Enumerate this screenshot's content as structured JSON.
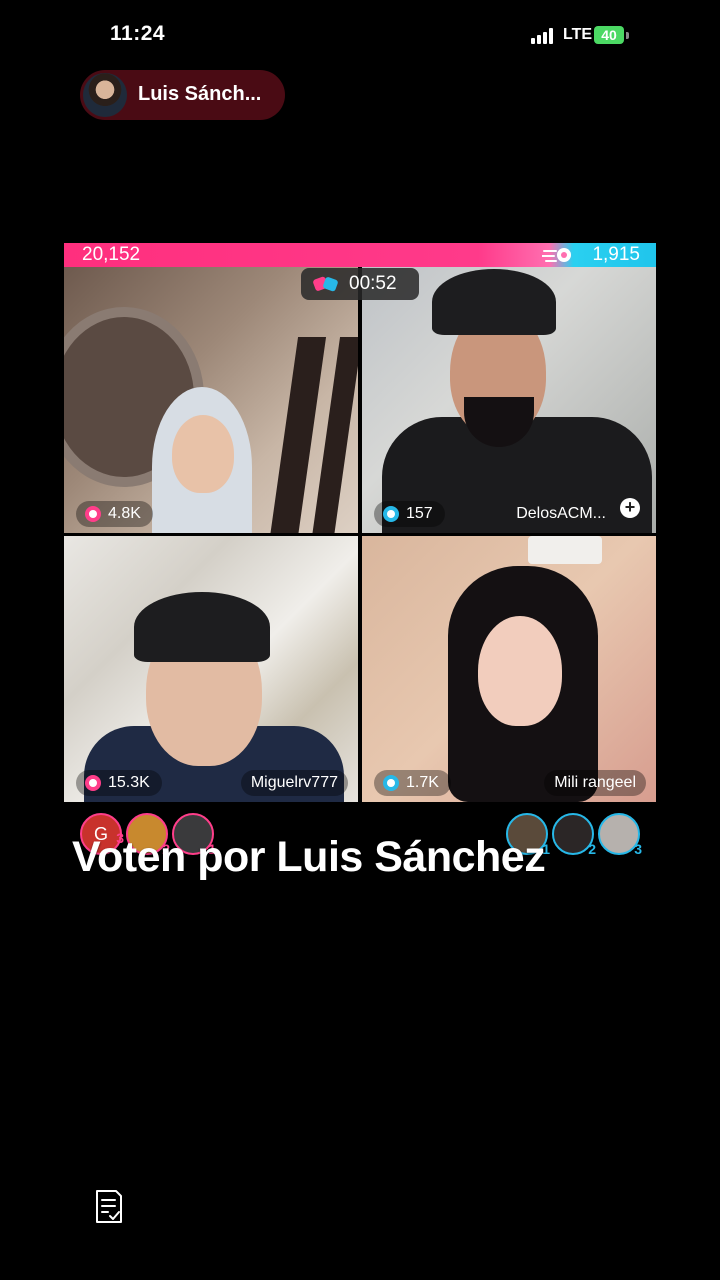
{
  "status": {
    "time": "11:24",
    "network": "LTE",
    "battery": "40"
  },
  "host": {
    "name": "Luis Sánch..."
  },
  "battle": {
    "left_score": "20,152",
    "right_score": "1,915",
    "timer": "00:52"
  },
  "tiles": [
    {
      "points": "4.8K",
      "username": "",
      "team_color": "#ff3e8a"
    },
    {
      "points": "157",
      "username": "DelosACM...",
      "team_color": "#27b8e8"
    },
    {
      "points": "15.3K",
      "username": "Miguelrv777",
      "team_color": "#ff3e8a"
    },
    {
      "points": "1.7K",
      "username": "Mili rangeel",
      "team_color": "#27b8e8"
    }
  ],
  "supporters": {
    "left": [
      {
        "letter": "G",
        "rank": "3"
      },
      {
        "letter": "",
        "rank": "2"
      },
      {
        "letter": "",
        "rank": "1"
      }
    ],
    "right": [
      {
        "rank": "1"
      },
      {
        "rank": "2"
      },
      {
        "rank": "3"
      }
    ]
  },
  "caption": "Voten por Luis Sánchez",
  "colors": {
    "pink": "#ff3e8a",
    "blue": "#27b8e8",
    "host_pill": "#4a0b14"
  },
  "icons": {
    "doc": "document-check-icon"
  }
}
